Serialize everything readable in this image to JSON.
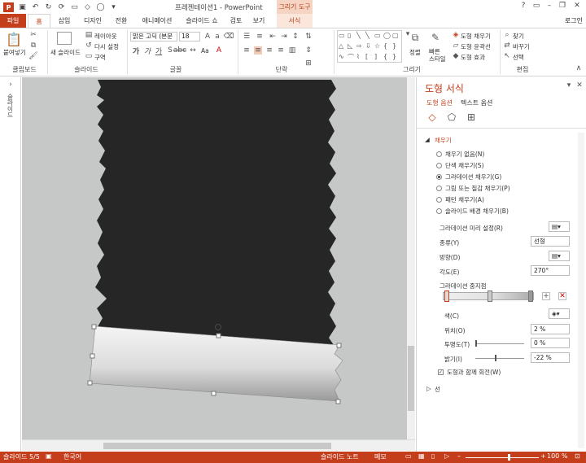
{
  "titlebar": {
    "app_icon": "P",
    "title": "프레젠테이션1 - PowerPoint",
    "context_group": "그리기 도구",
    "icons": [
      "save-icon",
      "undo-icon",
      "redo-icon",
      "repeat-icon",
      "slideshow-icon"
    ]
  },
  "tabs": [
    "파일",
    "홈",
    "삽입",
    "디자인",
    "전환",
    "애니메이션",
    "슬라이드 쇼",
    "검토",
    "보기",
    "서식"
  ],
  "login": "로그인",
  "ribbon": {
    "clipboard": {
      "paste": "붙여넣기",
      "label": "클립보드"
    },
    "slides": {
      "new": "새 슬라이드",
      "layout": "레이아웃",
      "reset": "다시 설정",
      "section": "구역",
      "label": "슬라이드"
    },
    "font": {
      "family": "맑은 고딕 (본문",
      "size": "18",
      "label": "글꼴",
      "aa": "Aa"
    },
    "paragraph": {
      "label": "단락"
    },
    "drawing": {
      "arrange": "정렬",
      "quick_styles": "빠른 스타일",
      "fill": "도형 채우기",
      "outline": "도형 윤곽선",
      "effects": "도형 효과",
      "label": "그리기"
    },
    "editing": {
      "find": "찾기",
      "replace": "바꾸기",
      "select": "선택",
      "label": "편집"
    }
  },
  "leftpane": {
    "label": "슬라이드"
  },
  "panel": {
    "title": "도형 서식",
    "tab_shape": "도형 옵션",
    "tab_text": "텍스트 옵션",
    "section_fill": "채우기",
    "fill_options": [
      "채우기 없음(N)",
      "단색 채우기(S)",
      "그라데이션 채우기(G)",
      "그림 또는 질감 채우기(P)",
      "패턴 채우기(A)",
      "슬라이드 배경 채우기(B)"
    ],
    "fill_selected_index": 2,
    "preset_label": "그라데이션 미리 설정(R)",
    "type_label": "종류(Y)",
    "type_value": "선형",
    "direction_label": "방향(D)",
    "angle_label": "각도(E)",
    "angle_value": "270°",
    "stops_label": "그라데이션 중지점",
    "color_label": "색(C)",
    "position_label": "위치(O)",
    "position_value": "2 %",
    "transparency_label": "투명도(T)",
    "transparency_value": "0 %",
    "brightness_label": "밝기(I)",
    "brightness_value": "-22 %",
    "rotate_label": "도형과 함께 회전(W)",
    "section_line": "선"
  },
  "status": {
    "slide": "슬라이드 5/5",
    "language": "한국어",
    "notes": "슬라이드 노트",
    "comments": "메모",
    "zoom": "100 %"
  },
  "colors": {
    "accent": "#c43e1c",
    "canvas": "#c6c8c8",
    "shape_dark": "#262626"
  }
}
